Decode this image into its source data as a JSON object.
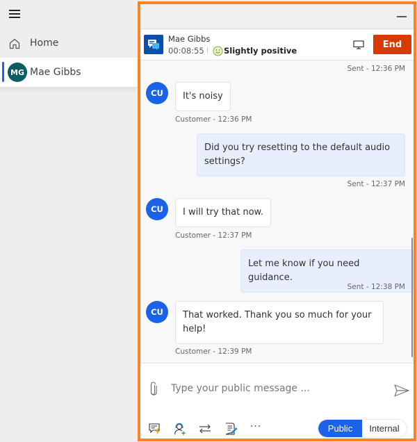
{
  "sidebar": {
    "menu_icon": "hamburger-menu-icon",
    "items": [
      {
        "label": "Home",
        "icon": "home-icon"
      },
      {
        "label": "Mae Gibbs",
        "avatar_initials": "MG",
        "avatar_color": "#0b5c63",
        "selected": true
      }
    ]
  },
  "window": {
    "minimize_icon": "minimize-icon"
  },
  "session": {
    "contact_name": "Mae Gibbs",
    "timer": "00:08:55",
    "separator": "|",
    "sentiment": "Slightly positive",
    "sentiment_icon": "slightly-smiling-face-icon",
    "channel_icon": "chat-channel-icon",
    "screen_share_icon": "monitor-icon",
    "end_label": "End",
    "end_color": "#d83b01"
  },
  "transcript": {
    "messages": [
      {
        "from": "agent",
        "meta": "Sent - 12:36 PM",
        "text": null
      },
      {
        "from": "customer",
        "avatar": "CU",
        "text": "It's noisy",
        "meta": "Customer - 12:36 PM"
      },
      {
        "from": "agent",
        "text": "Did you try resetting to the default audio settings?",
        "meta": "Sent - 12:37 PM"
      },
      {
        "from": "customer",
        "avatar": "CU",
        "text": "I will try that now.",
        "meta": "Customer - 12:37 PM"
      },
      {
        "from": "agent",
        "text": "Let me know if you need guidance.",
        "meta": "Sent - 12:38 PM"
      },
      {
        "from": "customer",
        "avatar": "CU",
        "text": "That worked. Thank you so much for your help!",
        "meta": "Customer - 12:39 PM"
      }
    ]
  },
  "composer": {
    "placeholder": "Type your public message ...",
    "value": "",
    "attach_icon": "paperclip-icon",
    "send_icon": "send-icon",
    "tools": [
      {
        "name": "quick-replies",
        "icon": "quick-reply-icon"
      },
      {
        "name": "consult",
        "icon": "consult-agent-icon"
      },
      {
        "name": "transfer",
        "icon": "transfer-icon"
      },
      {
        "name": "notes",
        "icon": "notes-icon"
      },
      {
        "name": "more",
        "icon": "more-options-icon",
        "glyph": "···"
      }
    ],
    "mode_toggle": {
      "options": [
        "Public",
        "Internal"
      ],
      "selected": "Public"
    }
  },
  "colors": {
    "frame": "#fd8127",
    "accent": "#1a63e8",
    "agent_bubble": "#e8eefb"
  }
}
